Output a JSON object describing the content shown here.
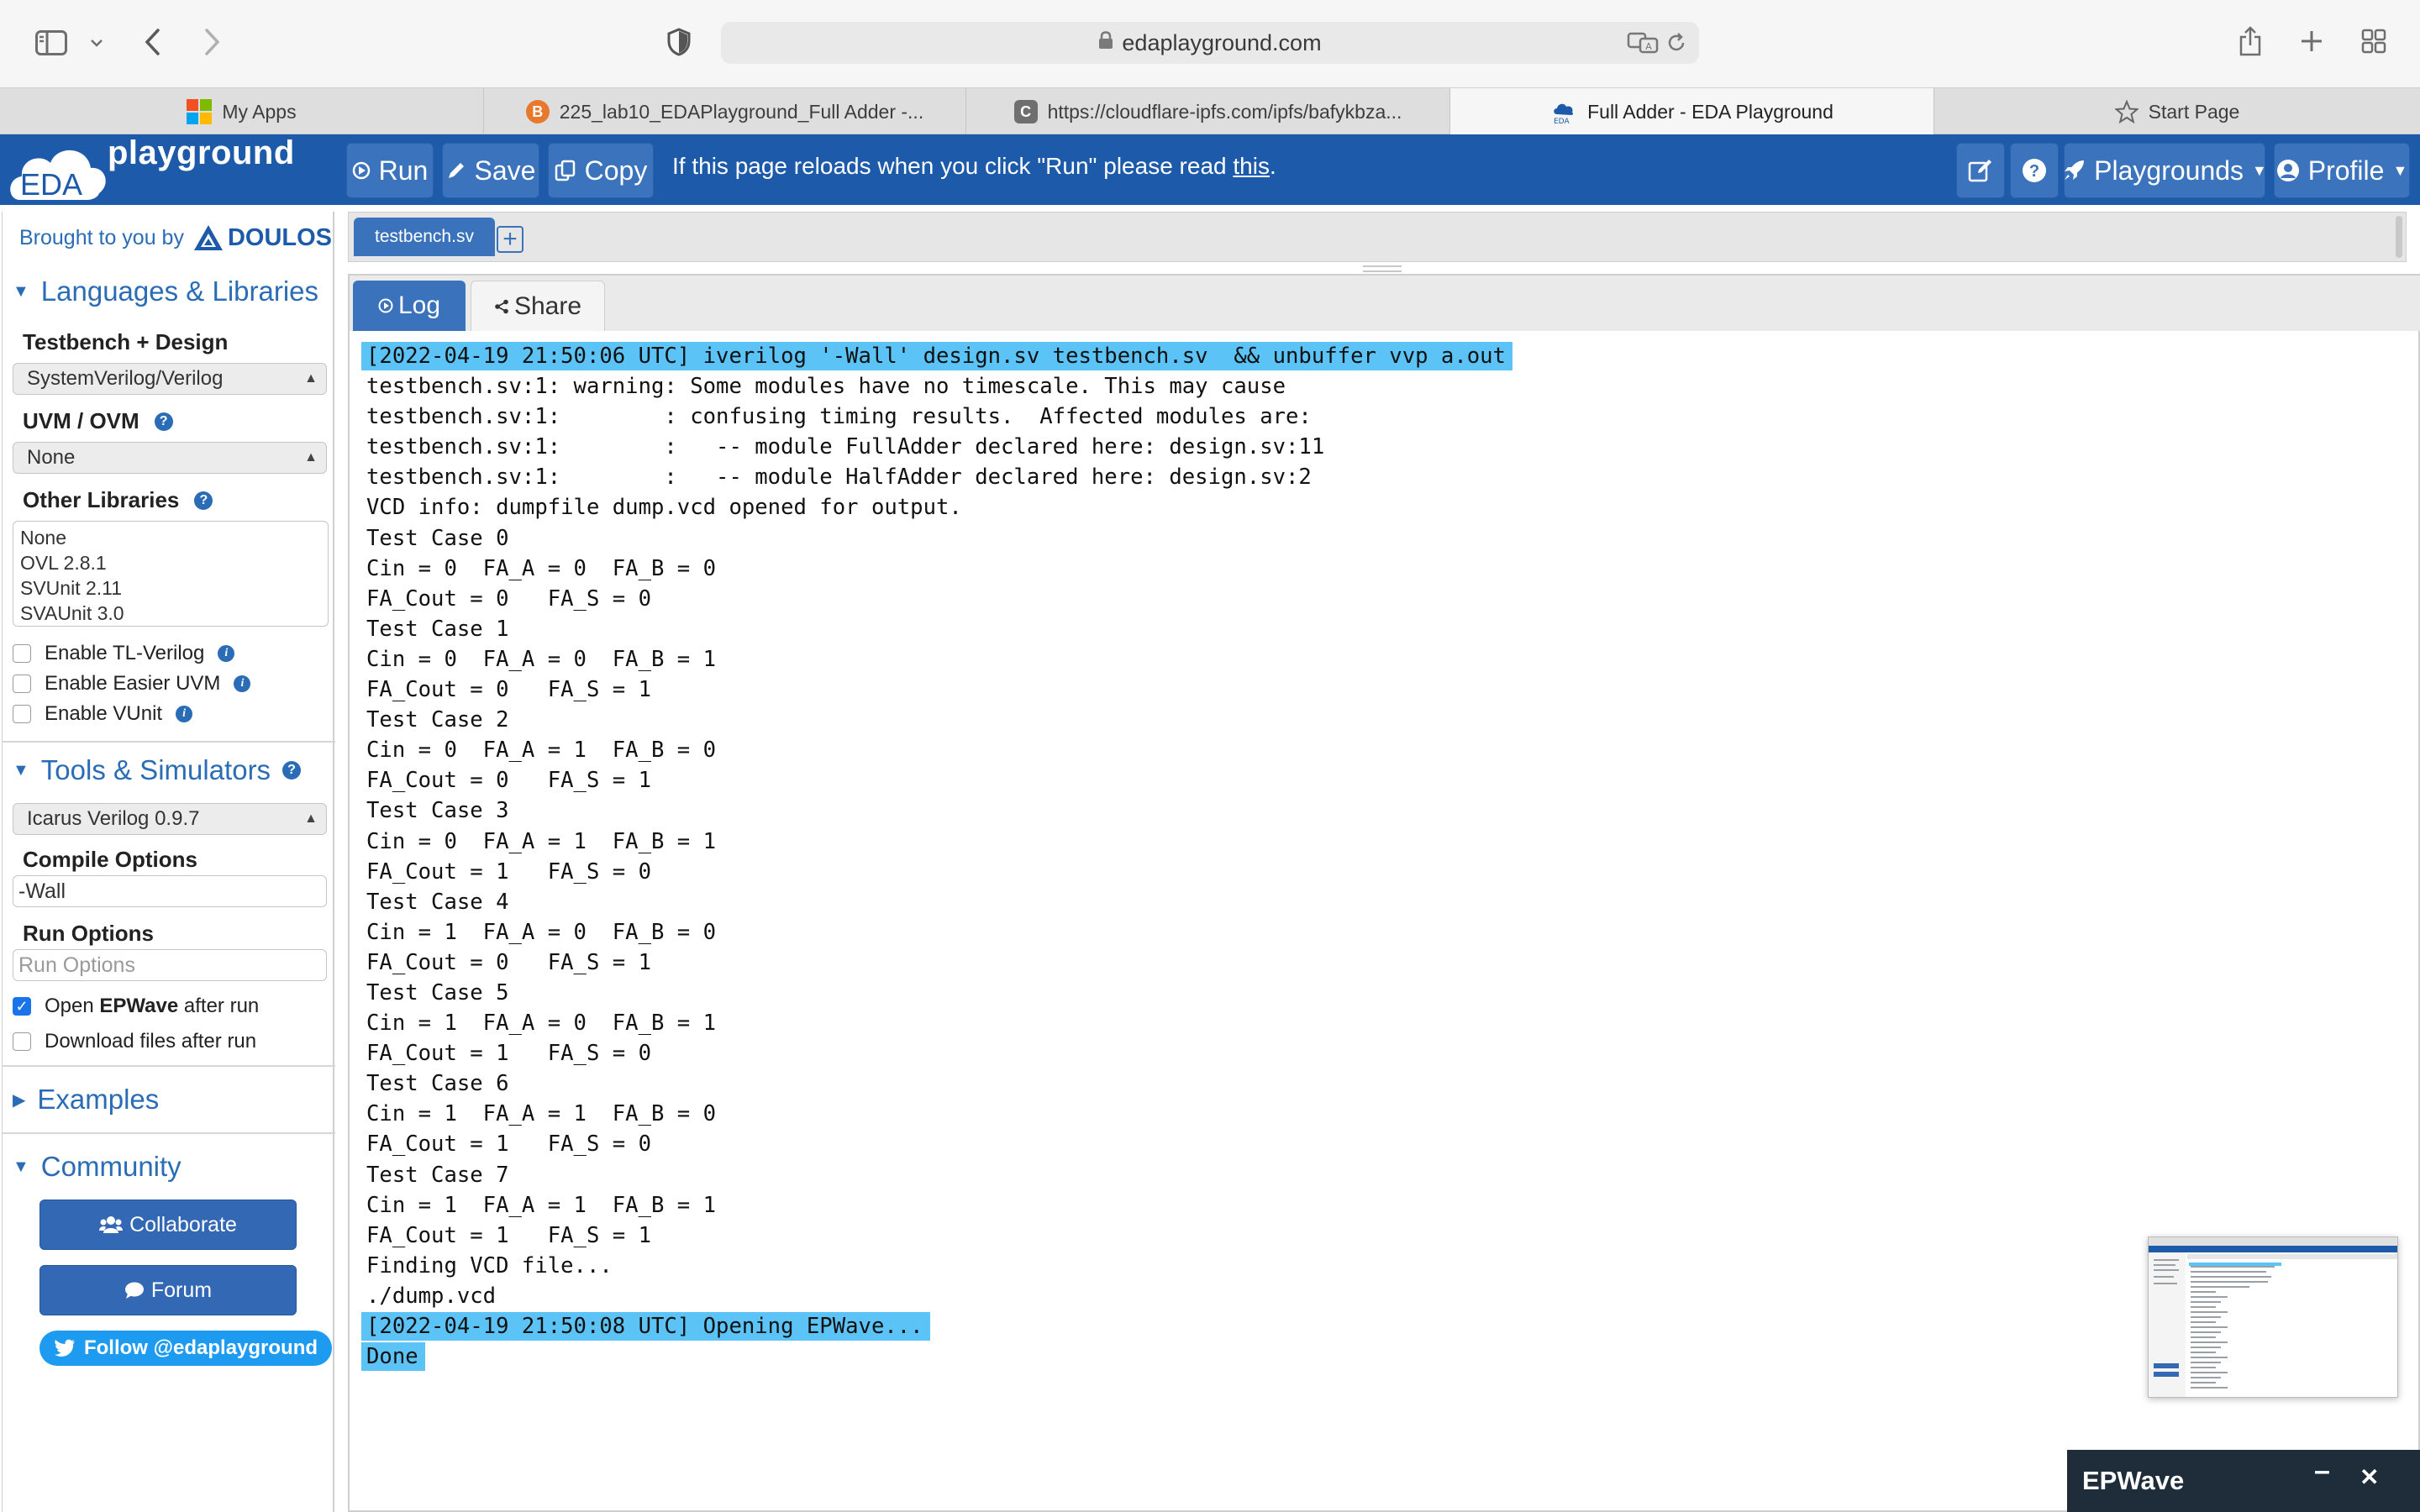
{
  "browser": {
    "url": "edaplayground.com",
    "tabs": [
      {
        "label": "My Apps",
        "icon": "windows-icon",
        "color": "#f25022"
      },
      {
        "label": "225_lab10_EDAPlayground_Full Adder -...",
        "icon": "blogger-icon",
        "color": "#e8782c"
      },
      {
        "label": "https://cloudflare-ipfs.com/ipfs/bafykbza...",
        "icon": "c-letter-icon",
        "color": "#6f6f6f"
      },
      {
        "label": "Full Adder - EDA Playground",
        "icon": "eda-cloud-icon",
        "color": "#1d5baa"
      },
      {
        "label": "Start Page",
        "icon": "star-icon",
        "color": "#666666"
      }
    ]
  },
  "header": {
    "logo_text": "playground",
    "logo_badge": "EDA",
    "run_label": "Run",
    "save_label": "Save",
    "copy_label": "Copy",
    "notice_prefix": "If this page reloads when you click \"Run\" please read ",
    "notice_link": "this",
    "notice_suffix": ".",
    "playgrounds_label": "Playgrounds",
    "profile_label": "Profile",
    "accent": "#1d5baa"
  },
  "sidebar": {
    "brought_by": "Brought to you by",
    "brand": "DOULOS",
    "languages_title": "Languages & Libraries",
    "testbench_label": "Testbench + Design",
    "testbench_value": "SystemVerilog/Verilog",
    "uvm_label": "UVM / OVM",
    "uvm_value": "None",
    "other_libraries_label": "Other Libraries",
    "libraries": [
      "None",
      "OVL 2.8.1",
      "SVUnit 2.11",
      "SVAUnit 3.0"
    ],
    "enable_tl": "Enable TL-Verilog",
    "enable_easier": "Enable Easier UVM",
    "enable_vunit": "Enable VUnit",
    "tools_title": "Tools & Simulators",
    "simulator_value": "Icarus Verilog 0.9.7",
    "compile_label": "Compile Options",
    "compile_value": "-Wall",
    "run_options_label": "Run Options",
    "run_options_placeholder": "Run Options",
    "open_epwave_prefix": "Open ",
    "open_epwave_bold": "EPWave",
    "open_epwave_suffix": " after run",
    "open_epwave_checked": true,
    "download_label": "Download files after run",
    "examples_title": "Examples",
    "community_title": "Community",
    "collaborate_label": "Collaborate",
    "forum_label": "Forum",
    "follow_label": "Follow @edaplayground"
  },
  "editor": {
    "file_tab": "testbench.sv"
  },
  "log": {
    "log_tab": "Log",
    "share_tab": "Share",
    "lines": [
      {
        "text": "[2022-04-19 21:50:06 UTC] iverilog '-Wall' design.sv testbench.sv  && unbuffer vvp a.out",
        "highlight": true
      },
      {
        "text": "testbench.sv:1: warning: Some modules have no timescale. This may cause",
        "highlight": false
      },
      {
        "text": "testbench.sv:1:        : confusing timing results.  Affected modules are:",
        "highlight": false
      },
      {
        "text": "testbench.sv:1:        :   -- module FullAdder declared here: design.sv:11",
        "highlight": false
      },
      {
        "text": "testbench.sv:1:        :   -- module HalfAdder declared here: design.sv:2",
        "highlight": false
      },
      {
        "text": "VCD info: dumpfile dump.vcd opened for output.",
        "highlight": false
      },
      {
        "text": "Test Case 0",
        "highlight": false
      },
      {
        "text": "Cin = 0  FA_A = 0  FA_B = 0",
        "highlight": false
      },
      {
        "text": "FA_Cout = 0   FA_S = 0",
        "highlight": false
      },
      {
        "text": "Test Case 1",
        "highlight": false
      },
      {
        "text": "Cin = 0  FA_A = 0  FA_B = 1",
        "highlight": false
      },
      {
        "text": "FA_Cout = 0   FA_S = 1",
        "highlight": false
      },
      {
        "text": "Test Case 2",
        "highlight": false
      },
      {
        "text": "Cin = 0  FA_A = 1  FA_B = 0",
        "highlight": false
      },
      {
        "text": "FA_Cout = 0   FA_S = 1",
        "highlight": false
      },
      {
        "text": "Test Case 3",
        "highlight": false
      },
      {
        "text": "Cin = 0  FA_A = 1  FA_B = 1",
        "highlight": false
      },
      {
        "text": "FA_Cout = 1   FA_S = 0",
        "highlight": false
      },
      {
        "text": "Test Case 4",
        "highlight": false
      },
      {
        "text": "Cin = 1  FA_A = 0  FA_B = 0",
        "highlight": false
      },
      {
        "text": "FA_Cout = 0   FA_S = 1",
        "highlight": false
      },
      {
        "text": "Test Case 5",
        "highlight": false
      },
      {
        "text": "Cin = 1  FA_A = 0  FA_B = 1",
        "highlight": false
      },
      {
        "text": "FA_Cout = 1   FA_S = 0",
        "highlight": false
      },
      {
        "text": "Test Case 6",
        "highlight": false
      },
      {
        "text": "Cin = 1  FA_A = 1  FA_B = 0",
        "highlight": false
      },
      {
        "text": "FA_Cout = 1   FA_S = 0",
        "highlight": false
      },
      {
        "text": "Test Case 7",
        "highlight": false
      },
      {
        "text": "Cin = 1  FA_A = 1  FA_B = 1",
        "highlight": false
      },
      {
        "text": "FA_Cout = 1   FA_S = 1",
        "highlight": false
      },
      {
        "text": "Finding VCD file...",
        "highlight": false
      },
      {
        "text": "./dump.vcd",
        "highlight": false
      },
      {
        "text": "[2022-04-19 21:50:08 UTC] Opening EPWave...",
        "highlight": true
      },
      {
        "text": "Done",
        "highlight": true
      }
    ],
    "highlight_color": "#5bc3f5"
  },
  "epwave": {
    "title": "EPWave",
    "minimize": "–",
    "close": "✕"
  }
}
